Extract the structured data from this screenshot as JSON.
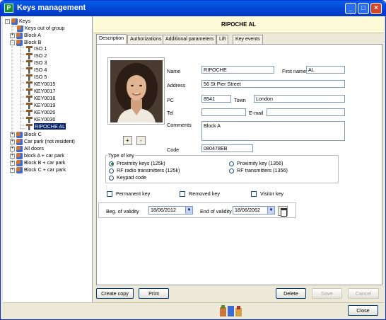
{
  "window": {
    "title": "Keys management",
    "app_icon_letter": "P"
  },
  "tree": {
    "root": "Keys",
    "items": [
      {
        "label": "Keys out of group",
        "icon": "group-icon"
      },
      {
        "label": "Block A",
        "icon": "group-icon",
        "expander": "+"
      },
      {
        "label": "Block B",
        "icon": "group-icon",
        "expander": "-"
      },
      {
        "label": "ISO 1",
        "icon": "key-icon"
      },
      {
        "label": "ISO 2",
        "icon": "key-icon"
      },
      {
        "label": "ISO 3",
        "icon": "key-icon"
      },
      {
        "label": "ISO 4",
        "icon": "key-icon"
      },
      {
        "label": "ISO 5",
        "icon": "key-icon"
      },
      {
        "label": "KEY0015",
        "icon": "key-icon"
      },
      {
        "label": "KEY0017",
        "icon": "key-icon"
      },
      {
        "label": "KEY0018",
        "icon": "key-icon"
      },
      {
        "label": "KEY0019",
        "icon": "key-icon"
      },
      {
        "label": "KEY0020",
        "icon": "key-icon"
      },
      {
        "label": "KEY0030",
        "icon": "key-icon"
      },
      {
        "label": "RIPOCHE AL",
        "icon": "key-icon",
        "selected": true
      },
      {
        "label": "Block C",
        "icon": "group-icon",
        "expander": "+"
      },
      {
        "label": "Car park (not resident)",
        "icon": "group-icon",
        "expander": "+"
      },
      {
        "label": "All doors",
        "icon": "group-icon",
        "expander": "+"
      },
      {
        "label": "block A + car park",
        "icon": "group-icon",
        "expander": "+"
      },
      {
        "label": "Block B + car park",
        "icon": "group-icon",
        "expander": "+"
      },
      {
        "label": "Block C + car park",
        "icon": "group-icon",
        "expander": "+"
      }
    ]
  },
  "header": {
    "name": "RIPOCHE AL"
  },
  "tabs": [
    {
      "label": "Description",
      "active": true
    },
    {
      "label": "Authorizations"
    },
    {
      "label": "Additional parameters"
    },
    {
      "label": "Lift"
    },
    {
      "label": "Key events"
    }
  ],
  "photo": {
    "add_label": "+",
    "remove_label": "-"
  },
  "form": {
    "name_label": "Name",
    "name_value": "RIPOCHE",
    "firstname_label": "First name",
    "firstname_value": "AL",
    "address_label": "Address",
    "address_value": "56 St Pier Street",
    "pc_label": "PC",
    "pc_value": "8541",
    "town_label": "Town",
    "town_value": "London",
    "tel_label": "Tel",
    "tel_value": "",
    "email_label": "E-mail",
    "email_value": "",
    "comments_label": "Comments",
    "comments_value": "Block A",
    "code_label": "Code",
    "code_value": "080478EB"
  },
  "key_type": {
    "title": "Type of key",
    "options": [
      {
        "label": "Proximity keys (125k)",
        "checked": true
      },
      {
        "label": "RF radio transmitters (125k)",
        "checked": false
      },
      {
        "label": "Keypad code",
        "checked": false
      },
      {
        "label": "Proximity key (1356)",
        "checked": false
      },
      {
        "label": "RF transmitters (1356)",
        "checked": false
      }
    ]
  },
  "flags": {
    "permanent": "Permanent key",
    "removed": "Removed key",
    "visitor": "Visitor key"
  },
  "validity": {
    "beg_label": "Beg. of validity",
    "beg_value": "18/06/2012",
    "end_label": "End of validity",
    "end_value": "18/06/2062"
  },
  "buttons": {
    "create_copy": "Create copy",
    "print": "Print",
    "delete": "Delete",
    "save": "Save",
    "cancel": "Cancel",
    "close": "Close"
  }
}
